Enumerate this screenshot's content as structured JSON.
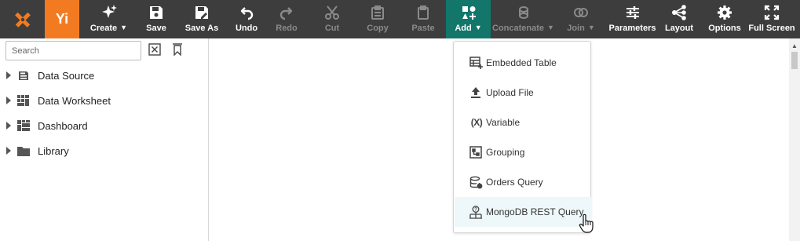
{
  "toolbar": {
    "logo_text": "Yi",
    "buttons": [
      {
        "label": "Create",
        "icon": "sparkle-icon",
        "disabled": false
      },
      {
        "label": "Save",
        "icon": "save-icon",
        "disabled": false
      },
      {
        "label": "Save As",
        "icon": "save-as-icon",
        "disabled": false
      },
      {
        "label": "Undo",
        "icon": "undo-icon",
        "disabled": false
      },
      {
        "label": "Redo",
        "icon": "redo-icon",
        "disabled": true
      },
      {
        "label": "Cut",
        "icon": "cut-icon",
        "disabled": true
      },
      {
        "label": "Copy",
        "icon": "copy-icon",
        "disabled": true
      },
      {
        "label": "Paste",
        "icon": "paste-icon",
        "disabled": true
      },
      {
        "label": "Add",
        "icon": "add-shapes-icon",
        "disabled": false,
        "active": true
      },
      {
        "label": "Concatenate",
        "icon": "concatenate-icon",
        "disabled": true
      },
      {
        "label": "Join",
        "icon": "join-icon",
        "disabled": true
      },
      {
        "label": "Parameters",
        "icon": "sliders-icon",
        "disabled": false
      },
      {
        "label": "Layout",
        "icon": "layout-icon",
        "disabled": false
      },
      {
        "label": "Options",
        "icon": "gear-icon",
        "disabled": false
      },
      {
        "label": "Full Screen",
        "icon": "fullscreen-icon",
        "disabled": false
      }
    ]
  },
  "colors": {
    "toolbar_bg": "#3d3d3d",
    "brand_orange": "#f27b21",
    "active_teal": "#12766a",
    "disabled_text": "#8a8a8a",
    "hover_row": "#eef7f9"
  },
  "search": {
    "placeholder": "Search",
    "value": ""
  },
  "tree": [
    {
      "label": "Data Source",
      "icon": "data-source-icon"
    },
    {
      "label": "Data Worksheet",
      "icon": "data-worksheet-icon"
    },
    {
      "label": "Dashboard",
      "icon": "dashboard-icon"
    },
    {
      "label": "Library",
      "icon": "folder-icon"
    }
  ],
  "add_menu": {
    "items": [
      {
        "label": "Embedded Table",
        "icon": "embedded-table-icon"
      },
      {
        "label": "Upload File",
        "icon": "upload-icon"
      },
      {
        "label": "Variable",
        "icon": "variable-icon",
        "glyph": "(X)"
      },
      {
        "label": "Grouping",
        "icon": "grouping-icon"
      },
      {
        "label": "Orders Query",
        "icon": "database-query-icon"
      },
      {
        "label": "MongoDB REST Query",
        "icon": "rest-query-icon",
        "hovered": true
      }
    ]
  }
}
